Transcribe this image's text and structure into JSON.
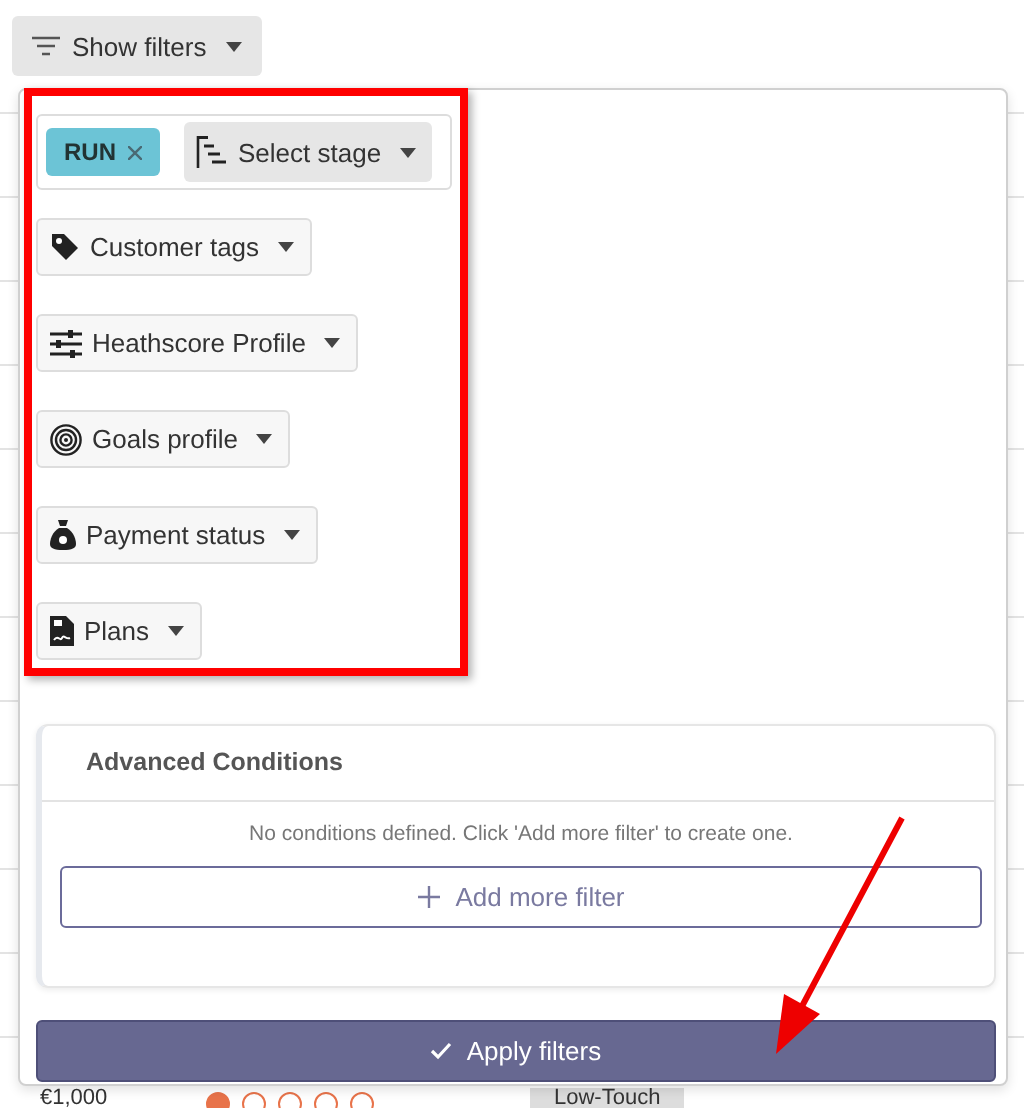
{
  "toolbar": {
    "show_filters": {
      "label": "Show filters"
    }
  },
  "filter_panel": {
    "stage_filter": {
      "tags": [
        {
          "label": "RUN"
        }
      ],
      "select": {
        "label": "Select stage"
      }
    },
    "filters": [
      {
        "label": "Customer tags",
        "kind": "tag"
      },
      {
        "label": "Heathscore Profile",
        "kind": "sliders"
      },
      {
        "label": "Goals profile",
        "kind": "target"
      },
      {
        "label": "Payment status",
        "kind": "moneybag"
      },
      {
        "label": "Plans",
        "kind": "document"
      }
    ],
    "advanced_conditions": {
      "title": "Advanced Conditions",
      "empty_message": "No conditions defined. Click 'Add more filter' to create one.",
      "add_button": "Add more filter"
    },
    "apply_button": {
      "label": "Apply filters"
    }
  },
  "background_row": {
    "amount": "€1,000",
    "stars": 1,
    "segment": "Low-Touch"
  }
}
